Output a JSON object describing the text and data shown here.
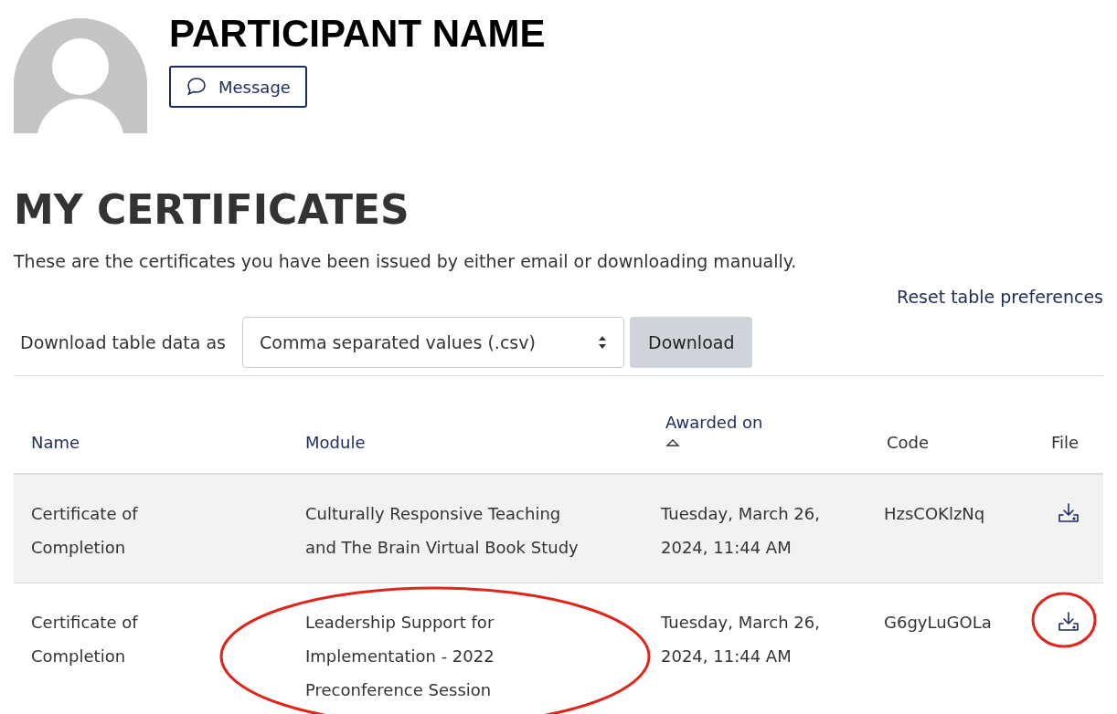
{
  "profile": {
    "name": "PARTICIPANT NAME",
    "message_button": "Message"
  },
  "heading": "MY CERTIFICATES",
  "intro": "These are the certificates you have been issued by either email or downloading manually.",
  "reset_link": "Reset table preferences",
  "download": {
    "label": "Download table data as",
    "format": "Comma separated values (.csv)",
    "button": "Download"
  },
  "table": {
    "columns": [
      {
        "label": "Name",
        "link": true,
        "sorted": false
      },
      {
        "label": "Module",
        "link": true,
        "sorted": false
      },
      {
        "label": "Awarded on",
        "link": true,
        "sorted": true
      },
      {
        "label": "Code",
        "link": false,
        "sorted": false
      },
      {
        "label": "File",
        "link": false,
        "sorted": false
      }
    ],
    "rows": [
      {
        "name": "Certificate of Completion",
        "module": "Culturally Responsive Teaching and The Brain Virtual Book Study",
        "module_circled": false,
        "awarded": "Tuesday, March 26, 2024, 11:44 AM",
        "code": "HzsCOKlzNq",
        "file_circled": false
      },
      {
        "name": "Certificate of Completion",
        "module": "Leadership Support for Implementation - 2022 Preconference Session",
        "module_circled": true,
        "awarded": "Tuesday, March 26, 2024, 11:44 AM",
        "code": "G6gyLuGOLa",
        "file_circled": true
      }
    ]
  }
}
